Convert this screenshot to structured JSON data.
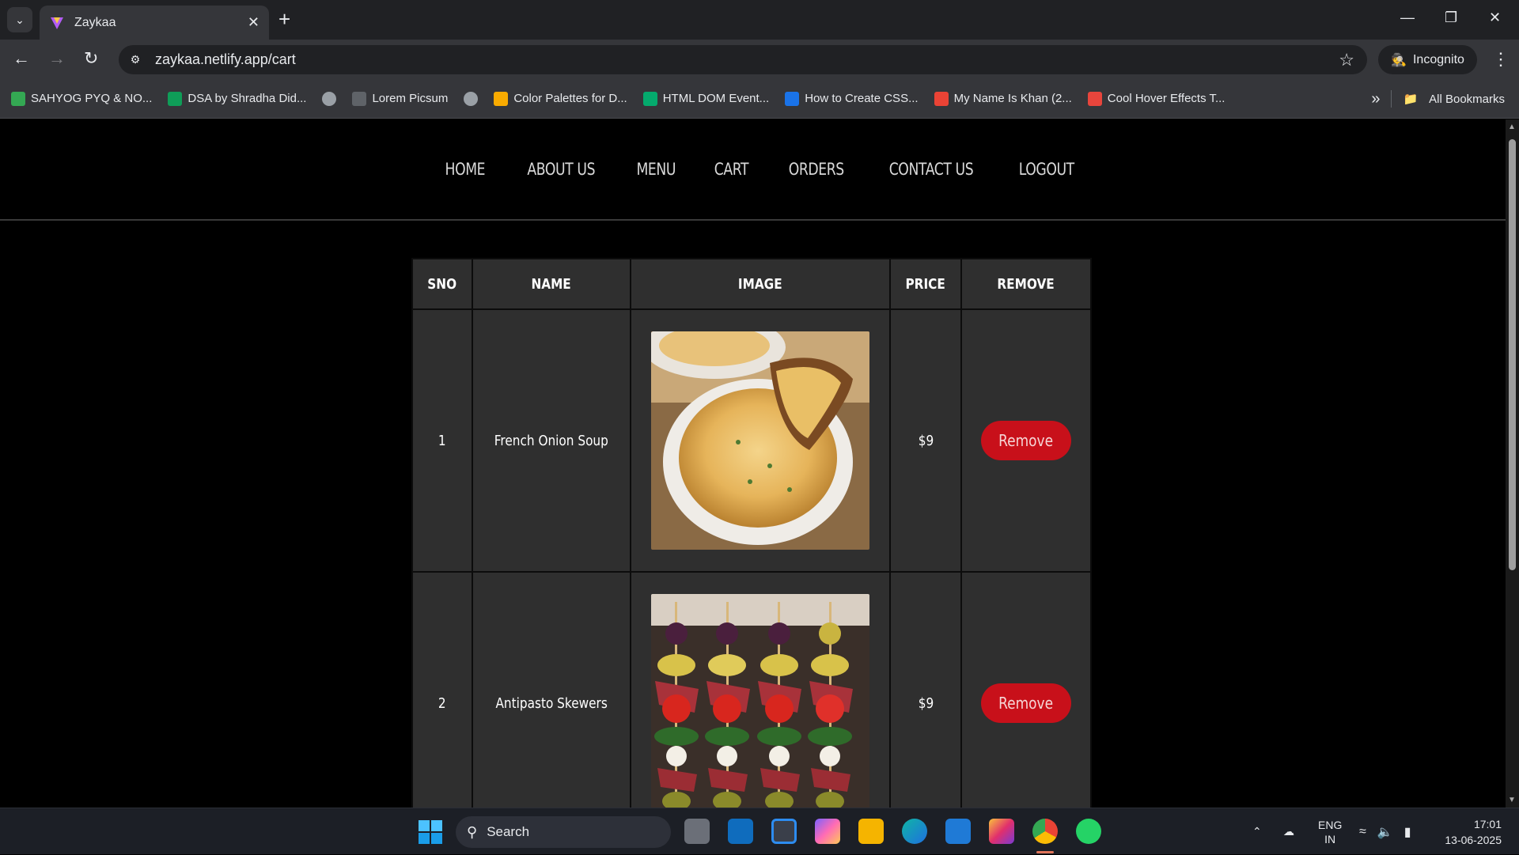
{
  "browser": {
    "tab_title": "Zaykaa",
    "url": "zaykaa.netlify.app/cart",
    "incognito_label": "Incognito",
    "bookmarks": [
      {
        "label": "SAHYOG PYQ & NO...",
        "color": "#34a853"
      },
      {
        "label": "DSA by Shradha Did...",
        "color": "#0f9d58"
      },
      {
        "label": "",
        "color": "#9aa0a6"
      },
      {
        "label": "Lorem Picsum",
        "color": "#5f6368"
      },
      {
        "label": "",
        "color": "#9aa0a6"
      },
      {
        "label": "Color Palettes for D...",
        "color": "#f9ab00"
      },
      {
        "label": "HTML DOM Event...",
        "color": "#04aa6d"
      },
      {
        "label": "How to Create CSS...",
        "color": "#1a73e8"
      },
      {
        "label": "My Name Is Khan (2...",
        "color": "#ea4335"
      },
      {
        "label": "Cool Hover Effects T...",
        "color": "#e8453c"
      }
    ],
    "all_bookmarks_label": "All Bookmarks"
  },
  "nav": {
    "items": [
      "HOME",
      "ABOUT US",
      "MENU",
      "CART",
      "ORDERS",
      "CONTACT US",
      "LOGOUT"
    ]
  },
  "cart": {
    "headers": [
      "SNO",
      "NAME",
      "IMAGE",
      "PRICE",
      "REMOVE"
    ],
    "rows": [
      {
        "sno": "1",
        "name": "French Onion Soup",
        "price": "$9",
        "remove_label": "Remove"
      },
      {
        "sno": "2",
        "name": "Antipasto Skewers",
        "price": "$9",
        "remove_label": "Remove"
      }
    ],
    "accent_color": "#c8101a"
  },
  "taskbar": {
    "search_label": "Search",
    "lang_top": "ENG",
    "lang_bottom": "IN",
    "time": "17:01",
    "date": "13-06-2025"
  }
}
